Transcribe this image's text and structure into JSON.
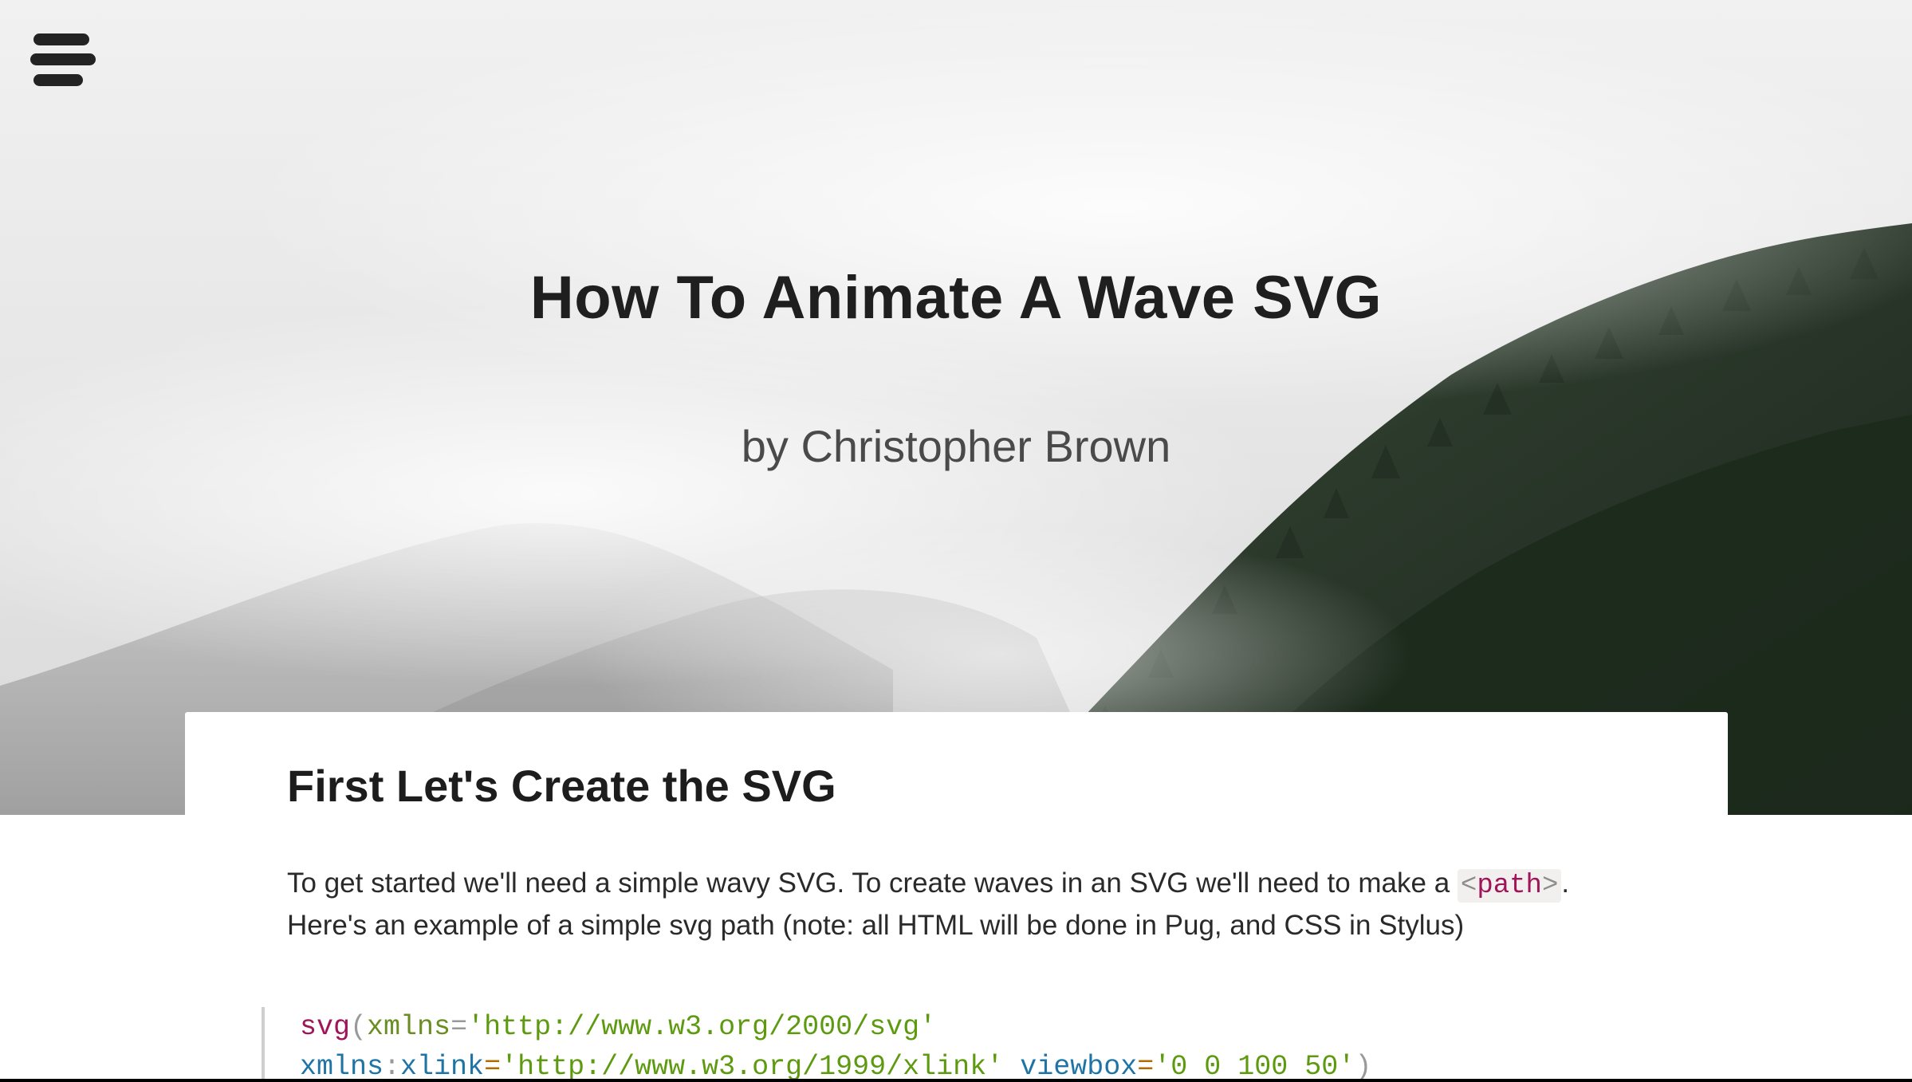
{
  "menu": {
    "icon": "hamburger-menu-icon"
  },
  "hero": {
    "title": "How To Animate A Wave SVG",
    "byline": "by Christopher Brown"
  },
  "article": {
    "heading": "First Let's Create the SVG",
    "paragraph_before_code": "To get started we'll need a simple wavy SVG. To create waves in an SVG we'll need to make a ",
    "inline_code": {
      "open": "<",
      "tag": "path",
      "close": ">"
    },
    "paragraph_after_code": ".",
    "paragraph_line2": "Here's an example of a simple svg path (note: all HTML will be done in Pug, and CSS in Stylus)",
    "code": {
      "line1": {
        "fn": "svg",
        "paren_open": "(",
        "attr": "xmlns",
        "eq": "=",
        "value": "'http://www.w3.org/2000/svg'"
      },
      "line2": {
        "attr_ns": "xmlns",
        "colon": ":",
        "attr_local": "xlink",
        "eq": "=",
        "value": "'http://www.w3.org/1999/xlink'",
        "attr2": "viewbox",
        "eq2": "=",
        "value2": "'0 0 100 50'",
        "paren_close": ")"
      }
    }
  },
  "colors": {
    "title": "#1f1f1f",
    "tag": "#a0155a",
    "string": "#5d9a0f",
    "attr": "#1f74a6"
  }
}
